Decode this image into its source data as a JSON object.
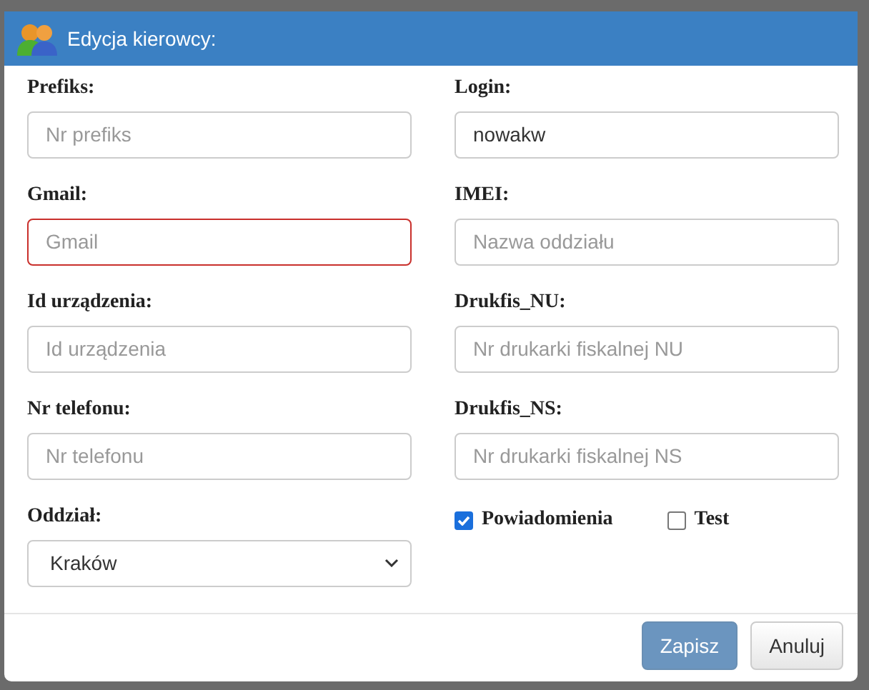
{
  "dialog": {
    "title": "Edycja kierowcy:"
  },
  "fields": [
    {
      "kind": "input",
      "label": "Prefiks:",
      "placeholder": "Nr prefiks",
      "error": false
    },
    {
      "kind": "input",
      "label": "Login:",
      "value": "nowakw",
      "error": false
    },
    {
      "kind": "input",
      "label": "Gmail:",
      "placeholder": "Gmail",
      "error": true
    },
    {
      "kind": "input",
      "label": "IMEI:",
      "placeholder": "Nazwa oddziału",
      "error": false
    },
    {
      "kind": "input",
      "label": "Id urządzenia:",
      "placeholder": "Id urządzenia",
      "error": false
    },
    {
      "kind": "input",
      "label": "Drukfis_NU:",
      "placeholder": "Nr drukarki fiskalnej NU",
      "error": false
    },
    {
      "kind": "input",
      "label": "Nr telefonu:",
      "placeholder": "Nr telefonu",
      "error": false
    },
    {
      "kind": "input",
      "label": "Drukfis_NS:",
      "placeholder": "Nr drukarki fiskalnej NS",
      "error": false
    },
    {
      "kind": "select",
      "label": "Oddział:",
      "value": "Kraków"
    },
    {
      "kind": "checkboxes",
      "items": [
        {
          "label": "Powiadomienia",
          "checked": true
        },
        {
          "label": "Test",
          "checked": false
        }
      ]
    }
  ],
  "buttons": [
    {
      "label": "Zapisz",
      "kind": "primary"
    },
    {
      "label": "Anuluj",
      "kind": "default"
    }
  ]
}
